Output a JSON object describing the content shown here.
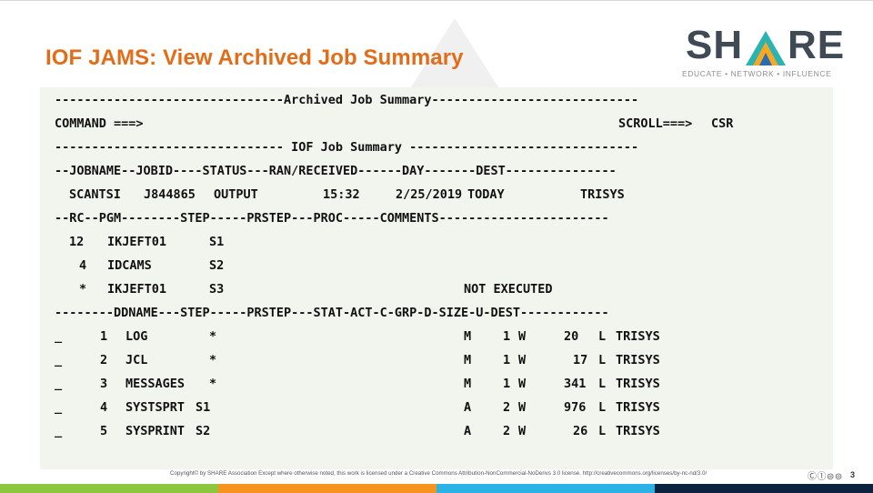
{
  "slide": {
    "title": "IOF JAMS:  View Archived Job Summary",
    "page_number": "3",
    "copyright": "Copyright© by SHARE Association Except where otherwise noted, this work is licensed under a Creative Commons Attribution-NonCommercial-NoDerivs 3.0 license. http://creativecommons.org/licenses/by-nc-nd/3.0/",
    "cc_badge": "Ⓒ①⊜⊜"
  },
  "logo": {
    "word_left": "SH",
    "word_right": "RE",
    "tagline": "EDUCATE • NETWORK • INFLUENCE",
    "colors": {
      "text": "#404a55",
      "tri_teal": "#2bb3b1",
      "tri_orange": "#f7a823",
      "tri_blue": "#2b6cb0"
    }
  },
  "terminal": {
    "header_line": "-------------------------------Archived Job Summary----------------------------",
    "command_label": "COMMAND ===>",
    "command_value": "",
    "scroll_label": "SCROLL===>",
    "scroll_value": "CSR",
    "summary_line": "------------------------------- IOF Job Summary -------------------------------",
    "job_header": "--JOBNAME--JOBID----STATUS---RAN/RECEIVED------DAY-------DEST---------------",
    "job": {
      "jobname": "SCANTSI",
      "jobid": "J844865",
      "status": "OUTPUT",
      "ran_time": "15:32",
      "ran_date": "2/25/2019",
      "day": "TODAY",
      "dest": "TRISYS"
    },
    "step_header": "--RC--PGM--------STEP-----PRSTEP---PROC-----COMMENTS-----------------------",
    "steps": [
      {
        "rc": "12",
        "pgm": "IKJEFT01",
        "step": "S1",
        "comments": ""
      },
      {
        "rc": "4",
        "pgm": "IDCAMS",
        "step": "S2",
        "comments": ""
      },
      {
        "rc": "*",
        "pgm": "IKJEFT01",
        "step": "S3",
        "comments": "NOT EXECUTED"
      }
    ],
    "dd_header": "--------DDNAME---STEP-----PRSTEP---STAT-ACT-C-GRP-D-SIZE-U-DEST------------",
    "datasets": [
      {
        "cmd": "_",
        "num": "1",
        "ddname": "LOG",
        "step": "*",
        "cls": "M",
        "grp": "1",
        "d": "W",
        "size": "20",
        "u": "L",
        "dest": "TRISYS"
      },
      {
        "cmd": "_",
        "num": "2",
        "ddname": "JCL",
        "step": "*",
        "cls": "M",
        "grp": "1",
        "d": "W",
        "size": "17",
        "u": "L",
        "dest": "TRISYS"
      },
      {
        "cmd": "_",
        "num": "3",
        "ddname": "MESSAGES",
        "step": "*",
        "cls": "M",
        "grp": "1",
        "d": "W",
        "size": "341",
        "u": "L",
        "dest": "TRISYS"
      },
      {
        "cmd": "_",
        "num": "4",
        "ddname": "SYSTSPRT",
        "step": "S1",
        "cls": "A",
        "grp": "2",
        "d": "W",
        "size": "976",
        "u": "L",
        "dest": "TRISYS"
      },
      {
        "cmd": "_",
        "num": "5",
        "ddname": "SYSPRINT",
        "step": "S2",
        "cls": "A",
        "grp": "2",
        "d": "W",
        "size": "26",
        "u": "L",
        "dest": "TRISYS"
      }
    ]
  },
  "colors": {
    "title": "#e36c19",
    "terminal_bg": "#f1f5ee",
    "footer_bars": [
      "#8dc63f",
      "#f7941d",
      "#2bb3e6",
      "#0c2340"
    ]
  }
}
